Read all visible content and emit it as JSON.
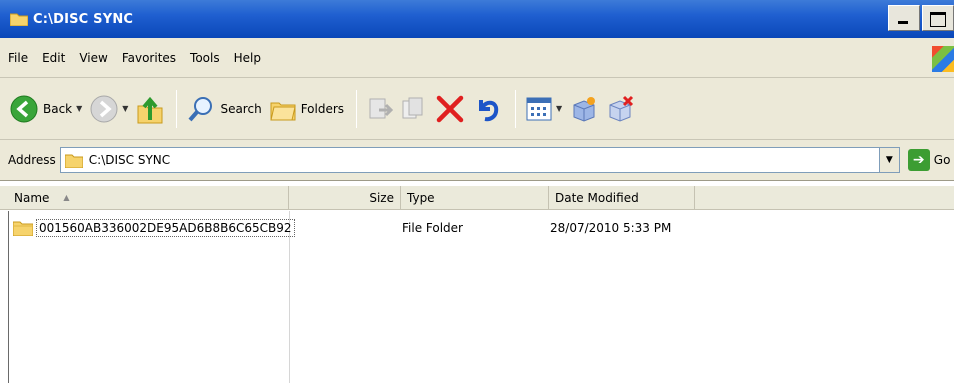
{
  "window": {
    "title": "C:\\DISC SYNC"
  },
  "menu": [
    "File",
    "Edit",
    "View",
    "Favorites",
    "Tools",
    "Help"
  ],
  "toolbar": {
    "back_label": "Back",
    "search_label": "Search",
    "folders_label": "Folders"
  },
  "address": {
    "label": "Address",
    "value": "C:\\DISC SYNC",
    "go_label": "Go"
  },
  "columns": {
    "name": "Name",
    "size": "Size",
    "type": "Type",
    "date": "Date Modified"
  },
  "files": [
    {
      "name": "001560AB336002DE95AD6B8B6C65CB92",
      "size": "",
      "type": "File Folder",
      "date": "28/07/2010 5:33 PM"
    }
  ],
  "colors": {
    "titlebar": "#0a47b8",
    "chrome": "#ece9d8",
    "folder": "#f6d36c",
    "delete": "#e02020"
  }
}
